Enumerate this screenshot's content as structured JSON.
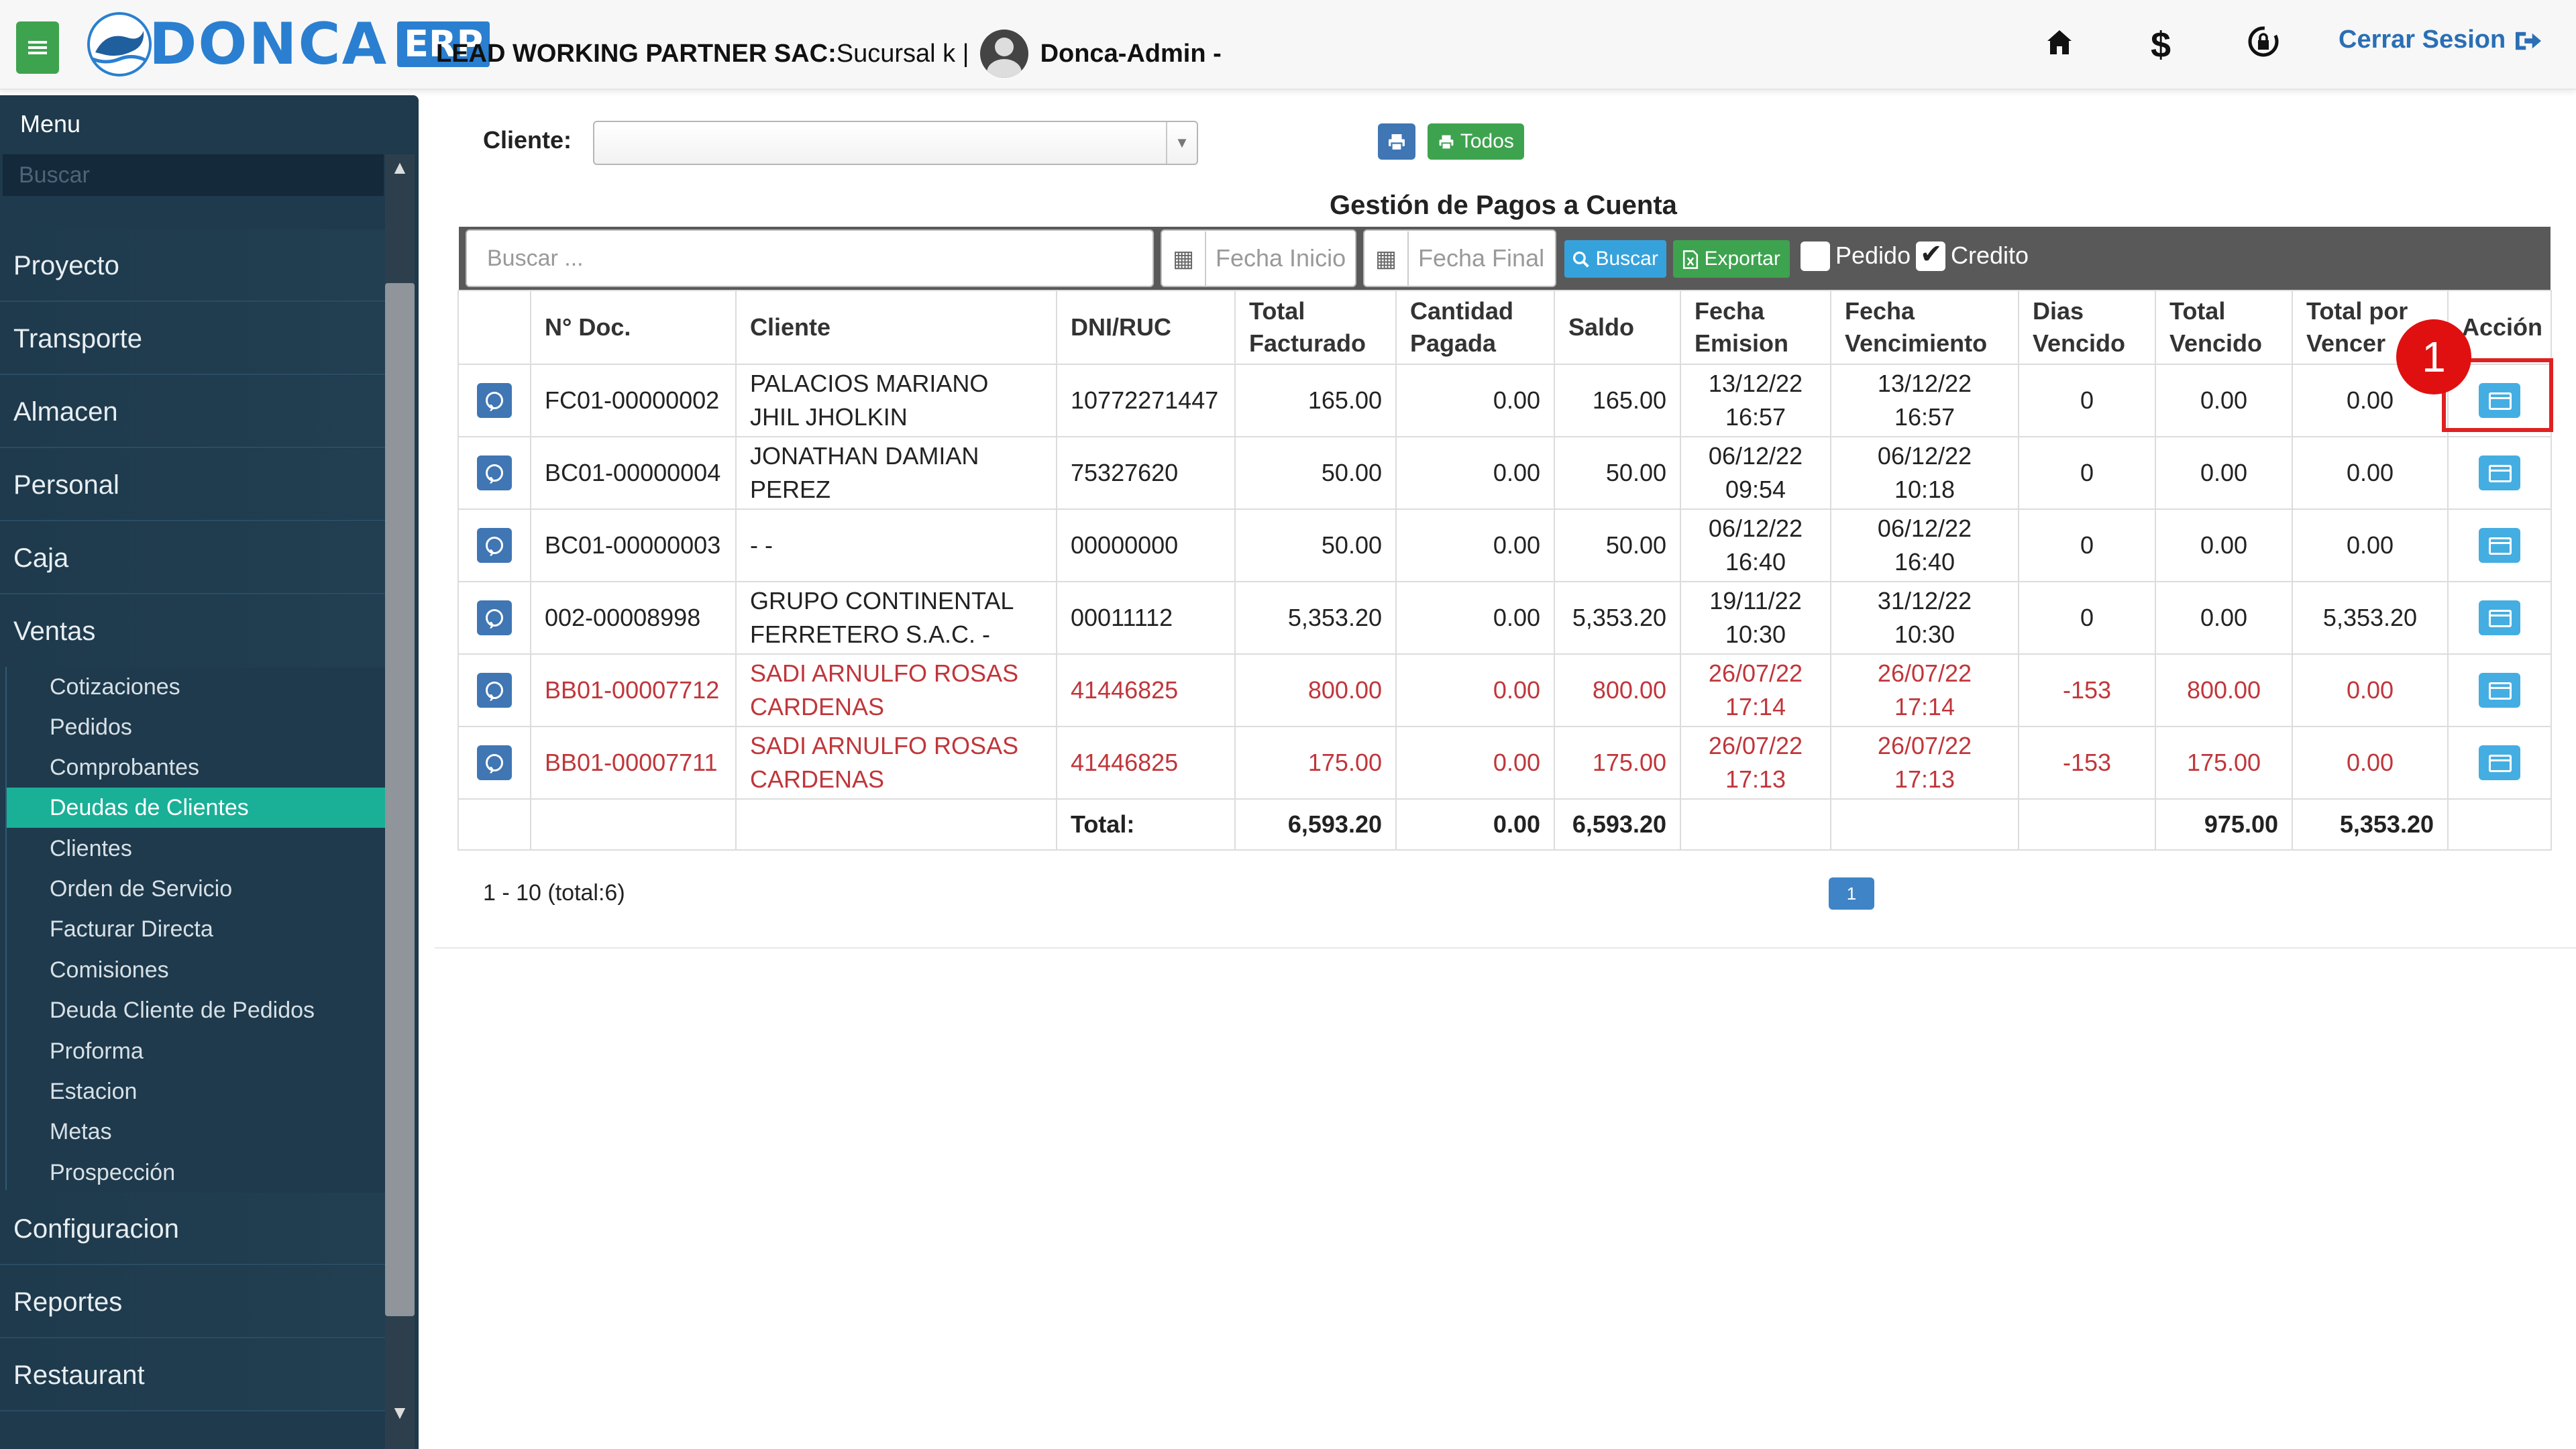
{
  "header": {
    "brand": "DONCA",
    "brand_suffix": "ERP",
    "company_bold": "LEAD WORKING PARTNER SAC:",
    "branch": " Sucursal k |",
    "user": "Donca-Admin -",
    "logout_label": "Cerrar Sesion",
    "icons": [
      "home-icon",
      "dollar-icon",
      "lock-refresh-icon",
      "logout-icon"
    ]
  },
  "sidebar": {
    "title": "Menu",
    "search_placeholder": "Buscar",
    "items": [
      "Proyecto",
      "Transporte",
      "Almacen",
      "Personal",
      "Caja",
      "Ventas"
    ],
    "sub_items": [
      "Cotizaciones",
      "Pedidos",
      "Comprobantes",
      "Deudas de Clientes",
      "Clientes",
      "Orden de Servicio",
      "Facturar Directa",
      "Comisiones",
      "Deuda Cliente de Pedidos",
      "Proforma",
      "Estacion",
      "Metas",
      "Prospección"
    ],
    "active_sub": "Deudas de Clientes",
    "bottom_items": [
      "Configuracion",
      "Reportes",
      "Restaurant"
    ]
  },
  "filters": {
    "cliente_label": "Cliente:",
    "cliente_value": "",
    "todos_label": "Todos"
  },
  "page": {
    "title": "Gestión de Pagos a Cuenta"
  },
  "toolbar": {
    "search_placeholder": "Buscar ...",
    "fecha_inicio": "Fecha Inicio",
    "fecha_final": "Fecha Final",
    "buscar_label": "Buscar",
    "exportar_label": "Exportar",
    "pedido_label": "Pedido",
    "pedido_checked": false,
    "credito_label": "Credito",
    "credito_checked": true
  },
  "table": {
    "headers": [
      "",
      "N° Doc.",
      "Cliente",
      "DNI/RUC",
      "Total Facturado",
      "Cantidad Pagada",
      "Saldo",
      "Fecha Emision",
      "Fecha Vencimiento",
      "Dias Vencido",
      "Total Vencido",
      "Total por Vencer",
      "Acción"
    ],
    "rows": [
      {
        "doc": "FC01-00000002",
        "cliente_1": "PALACIOS MARIANO",
        "cliente_2": "JHIL JHOLKIN",
        "ruc": "10772271447",
        "facturado": "165.00",
        "pagada": "0.00",
        "saldo": "165.00",
        "emision_1": "13/12/22",
        "emision_2": "16:57",
        "venc_1": "13/12/22",
        "venc_2": "16:57",
        "dias": "0",
        "vencido": "0.00",
        "por_vencer": "0.00",
        "overdue": false
      },
      {
        "doc": "BC01-00000004",
        "cliente_1": "JONATHAN DAMIAN",
        "cliente_2": "PEREZ",
        "ruc": "75327620",
        "facturado": "50.00",
        "pagada": "0.00",
        "saldo": "50.00",
        "emision_1": "06/12/22",
        "emision_2": "09:54",
        "venc_1": "06/12/22",
        "venc_2": "10:18",
        "dias": "0",
        "vencido": "0.00",
        "por_vencer": "0.00",
        "overdue": false
      },
      {
        "doc": "BC01-00000003",
        "cliente_1": "- -",
        "cliente_2": "",
        "ruc": "00000000",
        "facturado": "50.00",
        "pagada": "0.00",
        "saldo": "50.00",
        "emision_1": "06/12/22",
        "emision_2": "16:40",
        "venc_1": "06/12/22",
        "venc_2": "16:40",
        "dias": "0",
        "vencido": "0.00",
        "por_vencer": "0.00",
        "overdue": false
      },
      {
        "doc": "002-00008998",
        "cliente_1": "GRUPO CONTINENTAL",
        "cliente_2": "FERRETERO S.A.C. -",
        "ruc": "00011112",
        "facturado": "5,353.20",
        "pagada": "0.00",
        "saldo": "5,353.20",
        "emision_1": "19/11/22",
        "emision_2": "10:30",
        "venc_1": "31/12/22",
        "venc_2": "10:30",
        "dias": "0",
        "vencido": "0.00",
        "por_vencer": "5,353.20",
        "overdue": false
      },
      {
        "doc": "BB01-00007712",
        "cliente_1": "SADI ARNULFO ROSAS",
        "cliente_2": "CARDENAS",
        "ruc": "41446825",
        "facturado": "800.00",
        "pagada": "0.00",
        "saldo": "800.00",
        "emision_1": "26/07/22",
        "emision_2": "17:14",
        "venc_1": "26/07/22",
        "venc_2": "17:14",
        "dias": "-153",
        "vencido": "800.00",
        "por_vencer": "0.00",
        "overdue": true
      },
      {
        "doc": "BB01-00007711",
        "cliente_1": "SADI ARNULFO ROSAS",
        "cliente_2": "CARDENAS",
        "ruc": "41446825",
        "facturado": "175.00",
        "pagada": "0.00",
        "saldo": "175.00",
        "emision_1": "26/07/22",
        "emision_2": "17:13",
        "venc_1": "26/07/22",
        "venc_2": "17:13",
        "dias": "-153",
        "vencido": "175.00",
        "por_vencer": "0.00",
        "overdue": true
      }
    ],
    "totals": {
      "label": "Total:",
      "facturado": "6,593.20",
      "pagada": "0.00",
      "saldo": "6,593.20",
      "vencido": "975.00",
      "por_vencer": "5,353.20"
    }
  },
  "annotation": {
    "badge": "1"
  },
  "pager": {
    "info": "1 - 10 (total:6)",
    "current": "1"
  },
  "colors": {
    "sidebar_bg": "#1e3a4c",
    "active_item": "#19b097",
    "overdue_text": "#c0363b",
    "brand_blue": "#2a7fd0",
    "green": "#3ea34f"
  }
}
